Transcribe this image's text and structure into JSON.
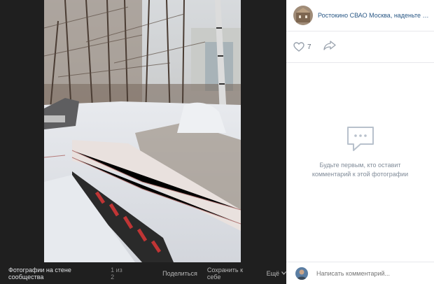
{
  "post": {
    "community": "Ростокино СВАО Москва, наденьте маску",
    "likes": "7"
  },
  "bottom_bar": {
    "album": "Фотографии на стене сообщества",
    "count": "1 из 2",
    "share": "Поделиться",
    "save": "Сохранить к себе",
    "more": "Ещё"
  },
  "comments": {
    "empty_line1": "Будьте первым, кто оставит",
    "empty_line2": "комментарий к этой фотографии",
    "placeholder": "Написать комментарий..."
  },
  "icons": [
    "heart-icon",
    "share-arrow-icon",
    "comment-bubble-icon",
    "chevron-down-icon"
  ],
  "colors": {
    "link": "#2a5885",
    "muted": "#818c99",
    "viewer_bg": "#1f1f1f"
  }
}
